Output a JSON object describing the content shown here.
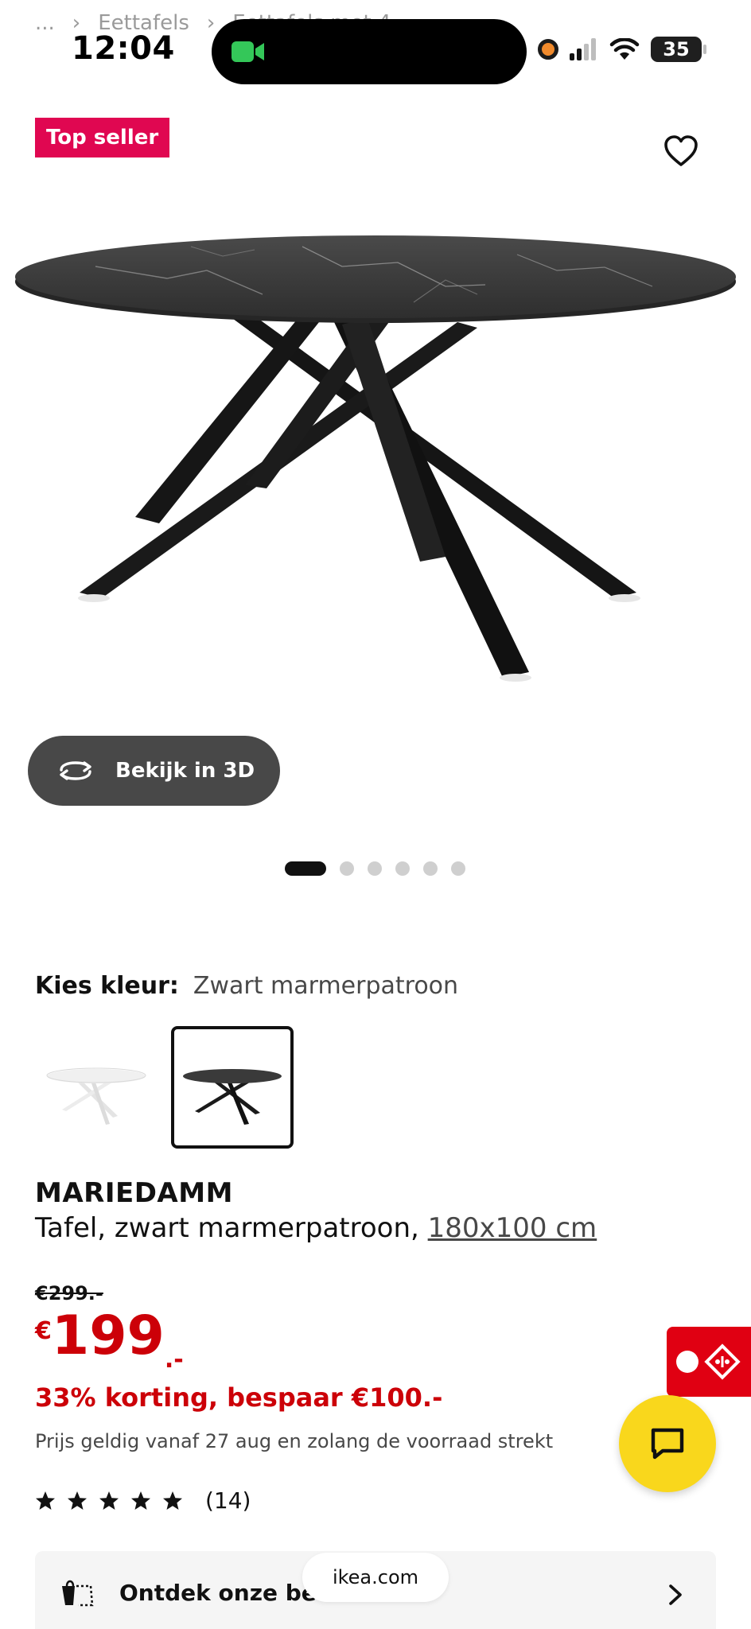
{
  "breadcrumb": {
    "ellipsis": "...",
    "item1": "Eettafels",
    "item2": "Eettafels met 4..."
  },
  "status": {
    "time": "12:04",
    "battery": "35"
  },
  "badge": {
    "label": "Top seller"
  },
  "view3d": {
    "label": "Bekijk in 3D"
  },
  "carousel": {
    "count": 6,
    "active_index": 0
  },
  "color": {
    "label": "Kies kleur:",
    "value": "Zwart marmerpatroon"
  },
  "product": {
    "name": "MARIEDAMM",
    "description": "Tafel, zwart marmerpatroon,",
    "size": "180x100 cm"
  },
  "price": {
    "old": "€299.-",
    "currency": "€",
    "amount": "199",
    "decimals": ".-",
    "discount": "33% korting, bespaar €100.-",
    "validity": "Prijs geldig vanaf 27 aug en zolang de voorraad strekt"
  },
  "rating": {
    "stars": 5,
    "count": "(14)"
  },
  "promo": {
    "label": "Ontdek onze beta"
  },
  "browser": {
    "url": "ikea.com"
  },
  "colors": {
    "brand_red": "#cc0008",
    "badge_pink": "#e00751",
    "fab_yellow": "#f9d71c"
  }
}
